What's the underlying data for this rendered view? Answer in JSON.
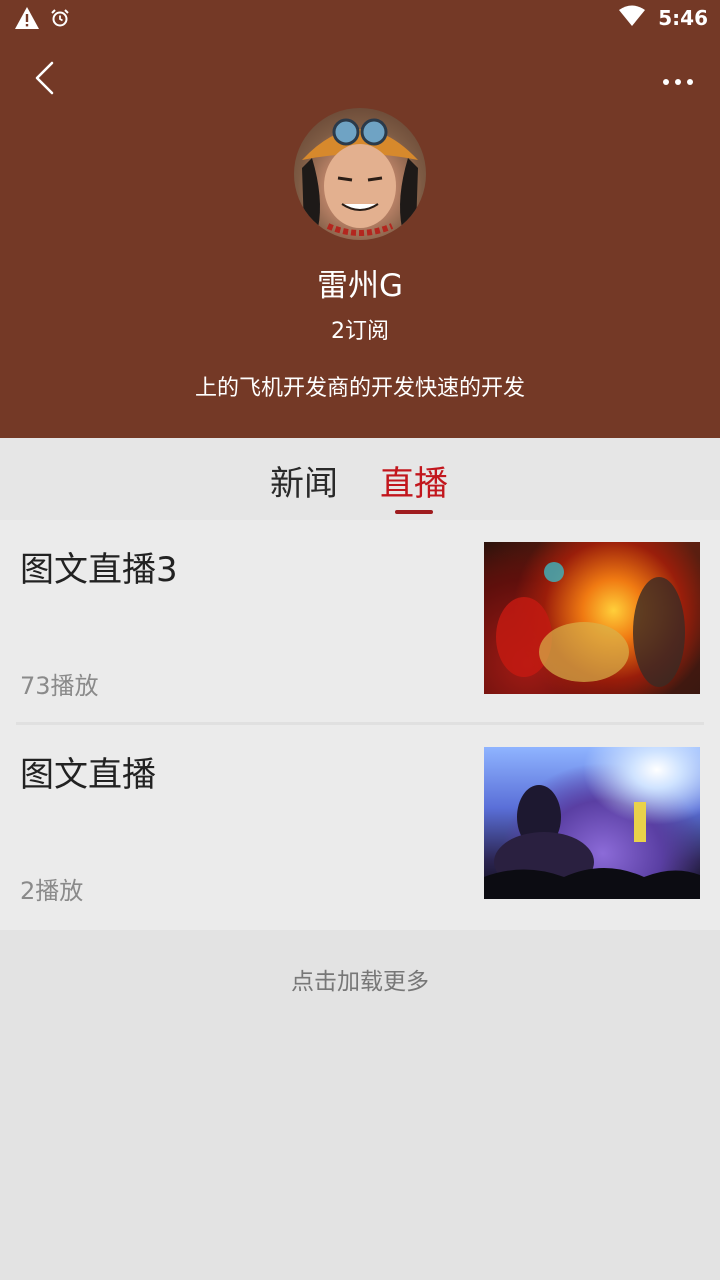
{
  "status": {
    "time": "5:46",
    "icons": [
      "warning-icon",
      "alarm-icon",
      "wifi-icon"
    ]
  },
  "header": {
    "username": "雷州G",
    "subscriptions": "2订阅",
    "bio": "上的飞机开发商的开发快速的开发",
    "bg_color": "#743926"
  },
  "tabs": [
    {
      "label": "新闻",
      "selected": false
    },
    {
      "label": "直播",
      "selected": true
    }
  ],
  "accent_color": "#c2161d",
  "items": [
    {
      "title": "图文直播3",
      "plays": "73播放"
    },
    {
      "title": "图文直播",
      "plays": "2播放"
    }
  ],
  "footer": {
    "load_more": "点击加载更多"
  }
}
